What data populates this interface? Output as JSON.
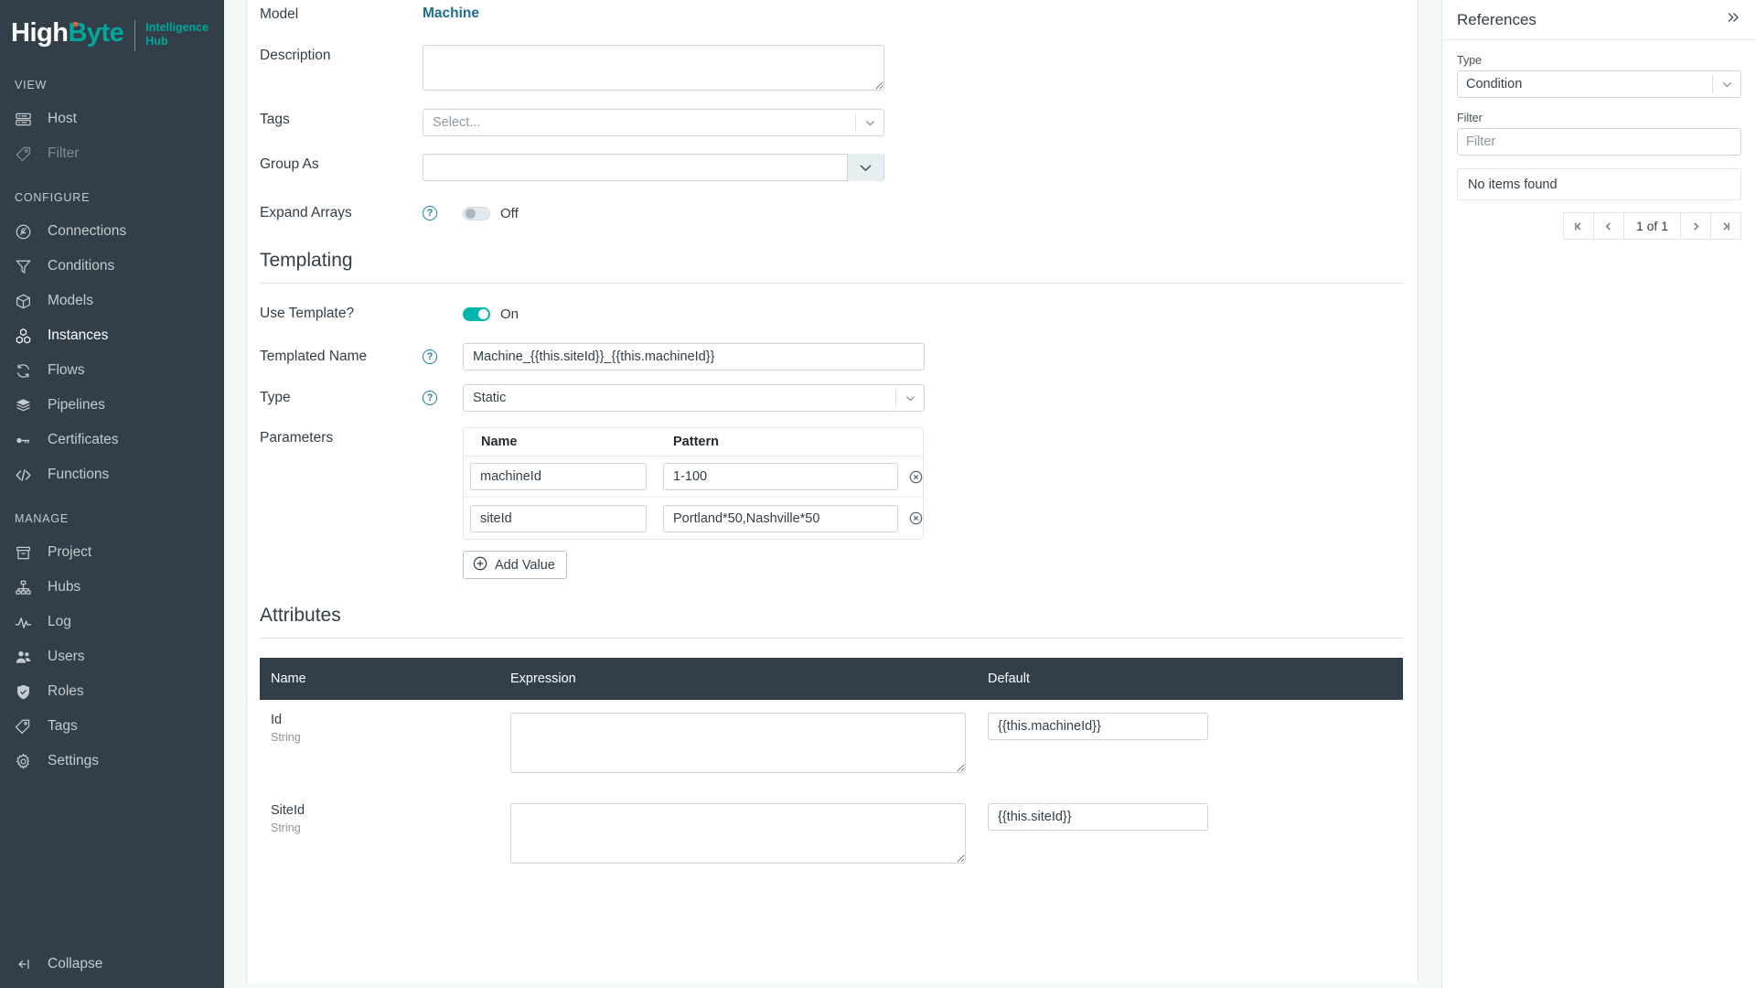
{
  "brand": {
    "name_first": "High",
    "name_second": "Byte",
    "sub_line1": "Intelligence",
    "sub_line2": "Hub",
    "accent": "#00a79d",
    "sidebar_bg": "#333f48"
  },
  "sidebar": {
    "groups": [
      {
        "header": "VIEW",
        "items": [
          {
            "label": "Host",
            "icon": "server-icon",
            "state": "normal"
          },
          {
            "label": "Filter",
            "icon": "tag-icon",
            "state": "disabled"
          }
        ]
      },
      {
        "header": "CONFIGURE",
        "items": [
          {
            "label": "Connections",
            "icon": "plug-icon",
            "state": "normal"
          },
          {
            "label": "Conditions",
            "icon": "funnel-icon",
            "state": "normal"
          },
          {
            "label": "Models",
            "icon": "box-icon",
            "state": "normal"
          },
          {
            "label": "Instances",
            "icon": "cubes-icon",
            "state": "active"
          },
          {
            "label": "Flows",
            "icon": "refresh-icon",
            "state": "normal"
          },
          {
            "label": "Pipelines",
            "icon": "layers-icon",
            "state": "normal"
          },
          {
            "label": "Certificates",
            "icon": "key-icon",
            "state": "normal"
          },
          {
            "label": "Functions",
            "icon": "code-icon",
            "state": "normal"
          }
        ]
      },
      {
        "header": "MANAGE",
        "items": [
          {
            "label": "Project",
            "icon": "archive-icon",
            "state": "normal"
          },
          {
            "label": "Hubs",
            "icon": "sitemap-icon",
            "state": "normal"
          },
          {
            "label": "Log",
            "icon": "pulse-icon",
            "state": "normal"
          },
          {
            "label": "Users",
            "icon": "users-icon",
            "state": "normal"
          },
          {
            "label": "Roles",
            "icon": "shield-check-icon",
            "state": "normal"
          },
          {
            "label": "Tags",
            "icon": "tag-icon",
            "state": "normal"
          },
          {
            "label": "Settings",
            "icon": "gear-icon",
            "state": "normal"
          }
        ]
      }
    ],
    "collapse_label": "Collapse",
    "collapse_icon": "collapse-left-icon"
  },
  "form": {
    "model": {
      "label": "Model",
      "value": "Machine"
    },
    "description": {
      "label": "Description",
      "value": "",
      "placeholder": ""
    },
    "tags": {
      "label": "Tags",
      "value": "",
      "placeholder": "Select..."
    },
    "group_as": {
      "label": "Group As",
      "value": ""
    },
    "expand_arrays": {
      "label": "Expand Arrays",
      "state": "Off",
      "on": false,
      "help": "?"
    }
  },
  "templating": {
    "section_title": "Templating",
    "use_template": {
      "label": "Use Template?",
      "state": "On",
      "on": true
    },
    "templated_name": {
      "label": "Templated Name",
      "value": "Machine_{{this.siteId}}_{{this.machineId}}",
      "help": "?"
    },
    "type": {
      "label": "Type",
      "value": "Static",
      "help": "?"
    },
    "parameters": {
      "label": "Parameters",
      "columns": [
        "Name",
        "Pattern"
      ],
      "rows": [
        {
          "name": "machineId",
          "pattern": "1-100"
        },
        {
          "name": "siteId",
          "pattern": "Portland*50,Nashville*50"
        }
      ],
      "add_button": "Add Value",
      "add_icon": "plus-circle-icon",
      "delete_icon": "close-circle-icon"
    }
  },
  "attributes": {
    "section_title": "Attributes",
    "columns": [
      "Name",
      "Expression",
      "Default"
    ],
    "rows": [
      {
        "name": "Id",
        "type": "String",
        "expression": "",
        "default": "{{this.machineId}}"
      },
      {
        "name": "SiteId",
        "type": "String",
        "expression": "",
        "default": "{{this.siteId}}"
      }
    ]
  },
  "references": {
    "title": "References",
    "collapse_icon": "chevron-double-right-icon",
    "type": {
      "label": "Type",
      "value": "Condition"
    },
    "filter": {
      "label": "Filter",
      "value": "",
      "placeholder": "Filter"
    },
    "empty_message": "No items found",
    "pager": {
      "first_icon": "page-first-icon",
      "prev_icon": "chevron-left-icon",
      "label": "1 of 1",
      "next_icon": "chevron-right-icon",
      "last_icon": "page-last-icon"
    }
  }
}
